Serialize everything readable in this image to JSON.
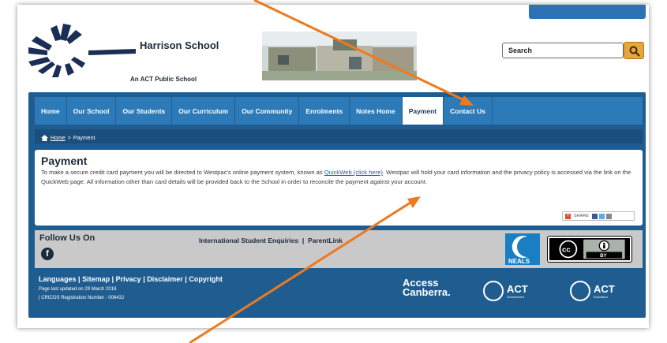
{
  "header": {
    "school_name": "Harrison School",
    "school_subtitle": "An ACT Public School",
    "search_label": "Search"
  },
  "nav": {
    "items": [
      {
        "label": "Home",
        "active": false
      },
      {
        "label": "Our School",
        "active": false
      },
      {
        "label": "Our Students",
        "active": false
      },
      {
        "label": "Our Curriculum",
        "active": false
      },
      {
        "label": "Our Community",
        "active": false
      },
      {
        "label": "Enrolments",
        "active": false
      },
      {
        "label": "Notes Home",
        "active": false
      },
      {
        "label": "Payment",
        "active": true
      },
      {
        "label": "Contact Us",
        "active": false
      }
    ]
  },
  "breadcrumb": {
    "home": "Home",
    "separator": ">",
    "current": "Payment"
  },
  "content": {
    "title": "Payment",
    "para_part1": "To make a secure credit card payment you will be directed to Westpac's online payment system, known as ",
    "link_text": "QuickWeb (click here)",
    "para_part2": ". Westpac will hold your card information and the privacy policy is accessed via the link on the QuickWeb page. All information other than card details will be provided back to the School in order to  reconcile the payment against your account.",
    "share_label": "SHARE"
  },
  "follow": {
    "title": "Follow Us On",
    "facebook_letter": "f",
    "link1": "International Student Enquiries",
    "link_sep": "|",
    "link2": "ParentLink",
    "neals_label": "NEALS",
    "cc_by": "BY"
  },
  "footer": {
    "links": [
      "Languages",
      "Sitemap",
      "Privacy",
      "Disclaimer",
      "Copyright"
    ],
    "link_sep": "|",
    "updated": "Page last updated on 29 March 2018",
    "cricos": "| CRICOS Registration Number : 00643J",
    "access_line1": "Access",
    "access_line2": "Canberra.",
    "act_label": "ACT",
    "act_gov": "Government",
    "act_edu": "Education"
  },
  "colors": {
    "nav_blue": "#2d7ab8",
    "panel_blue": "#1f5d91",
    "search_orange": "#e8a53a",
    "arrow_orange": "#ee7a1e",
    "follow_grey": "#c9c9c9"
  }
}
